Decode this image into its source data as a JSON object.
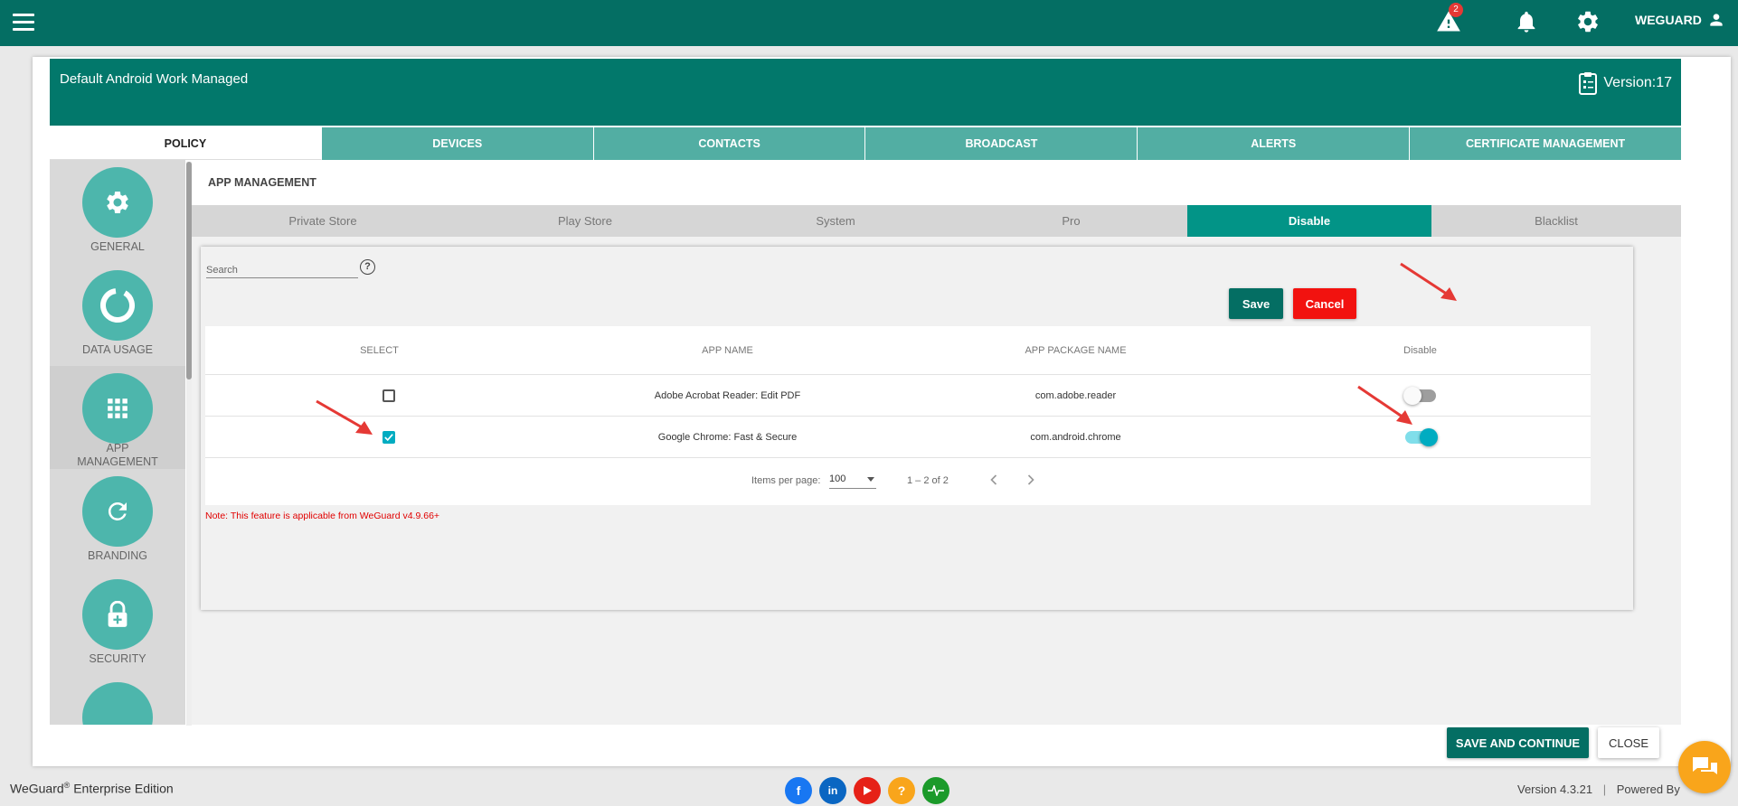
{
  "topbar": {
    "alert_count": "2",
    "user_name": "WEGUARD"
  },
  "header": {
    "title": "Default Android Work Managed",
    "version": "Version:17"
  },
  "tabs": [
    "POLICY",
    "DEVICES",
    "CONTACTS",
    "BROADCAST",
    "ALERTS",
    "CERTIFICATE MANAGEMENT"
  ],
  "sidebar": {
    "items": [
      {
        "label": "GENERAL",
        "icon": "gear-icon"
      },
      {
        "label": "DATA USAGE",
        "icon": "donut-icon"
      },
      {
        "label": "APP\nMANAGEMENT",
        "icon": "grid-icon"
      },
      {
        "label": "BRANDING",
        "icon": "refresh-icon"
      },
      {
        "label": "SECURITY",
        "icon": "lock-icon"
      }
    ]
  },
  "section": {
    "title": "APP MANAGEMENT",
    "subtabs": [
      "Private Store",
      "Play Store",
      "System",
      "Pro",
      "Disable",
      "Blacklist"
    ],
    "active_subtab": "Disable"
  },
  "search": {
    "placeholder": "Search",
    "help": "?"
  },
  "actions": {
    "save": "Save",
    "cancel": "Cancel"
  },
  "table": {
    "headers": [
      "SELECT",
      "APP NAME",
      "APP PACKAGE NAME",
      "Disable"
    ],
    "rows": [
      {
        "selected": false,
        "app_name": "Adobe Acrobat Reader: Edit PDF",
        "package": "com.adobe.reader",
        "disabled": false
      },
      {
        "selected": true,
        "app_name": "Google Chrome: Fast & Secure",
        "package": "com.android.chrome",
        "disabled": true
      }
    ]
  },
  "pager": {
    "label": "Items per page:",
    "per_page": "100",
    "range": "1 – 2 of 2"
  },
  "note": "Note: This feature is applicable from WeGuard v4.9.66+",
  "footer": {
    "save_continue": "SAVE AND CONTINUE",
    "close": "CLOSE"
  },
  "bottom": {
    "brand": "WeGuard",
    "brand_sup": "®",
    "edition": " Enterprise Edition",
    "version": "Version 4.3.21",
    "powered": "Powered By"
  },
  "colors": {
    "primary": "#046e63",
    "tab_bg": "#52aea3",
    "active_subtab": "#029487",
    "cancel": "#f2120f",
    "arrow": "#e53935",
    "toggle_on": "#00acc1"
  }
}
